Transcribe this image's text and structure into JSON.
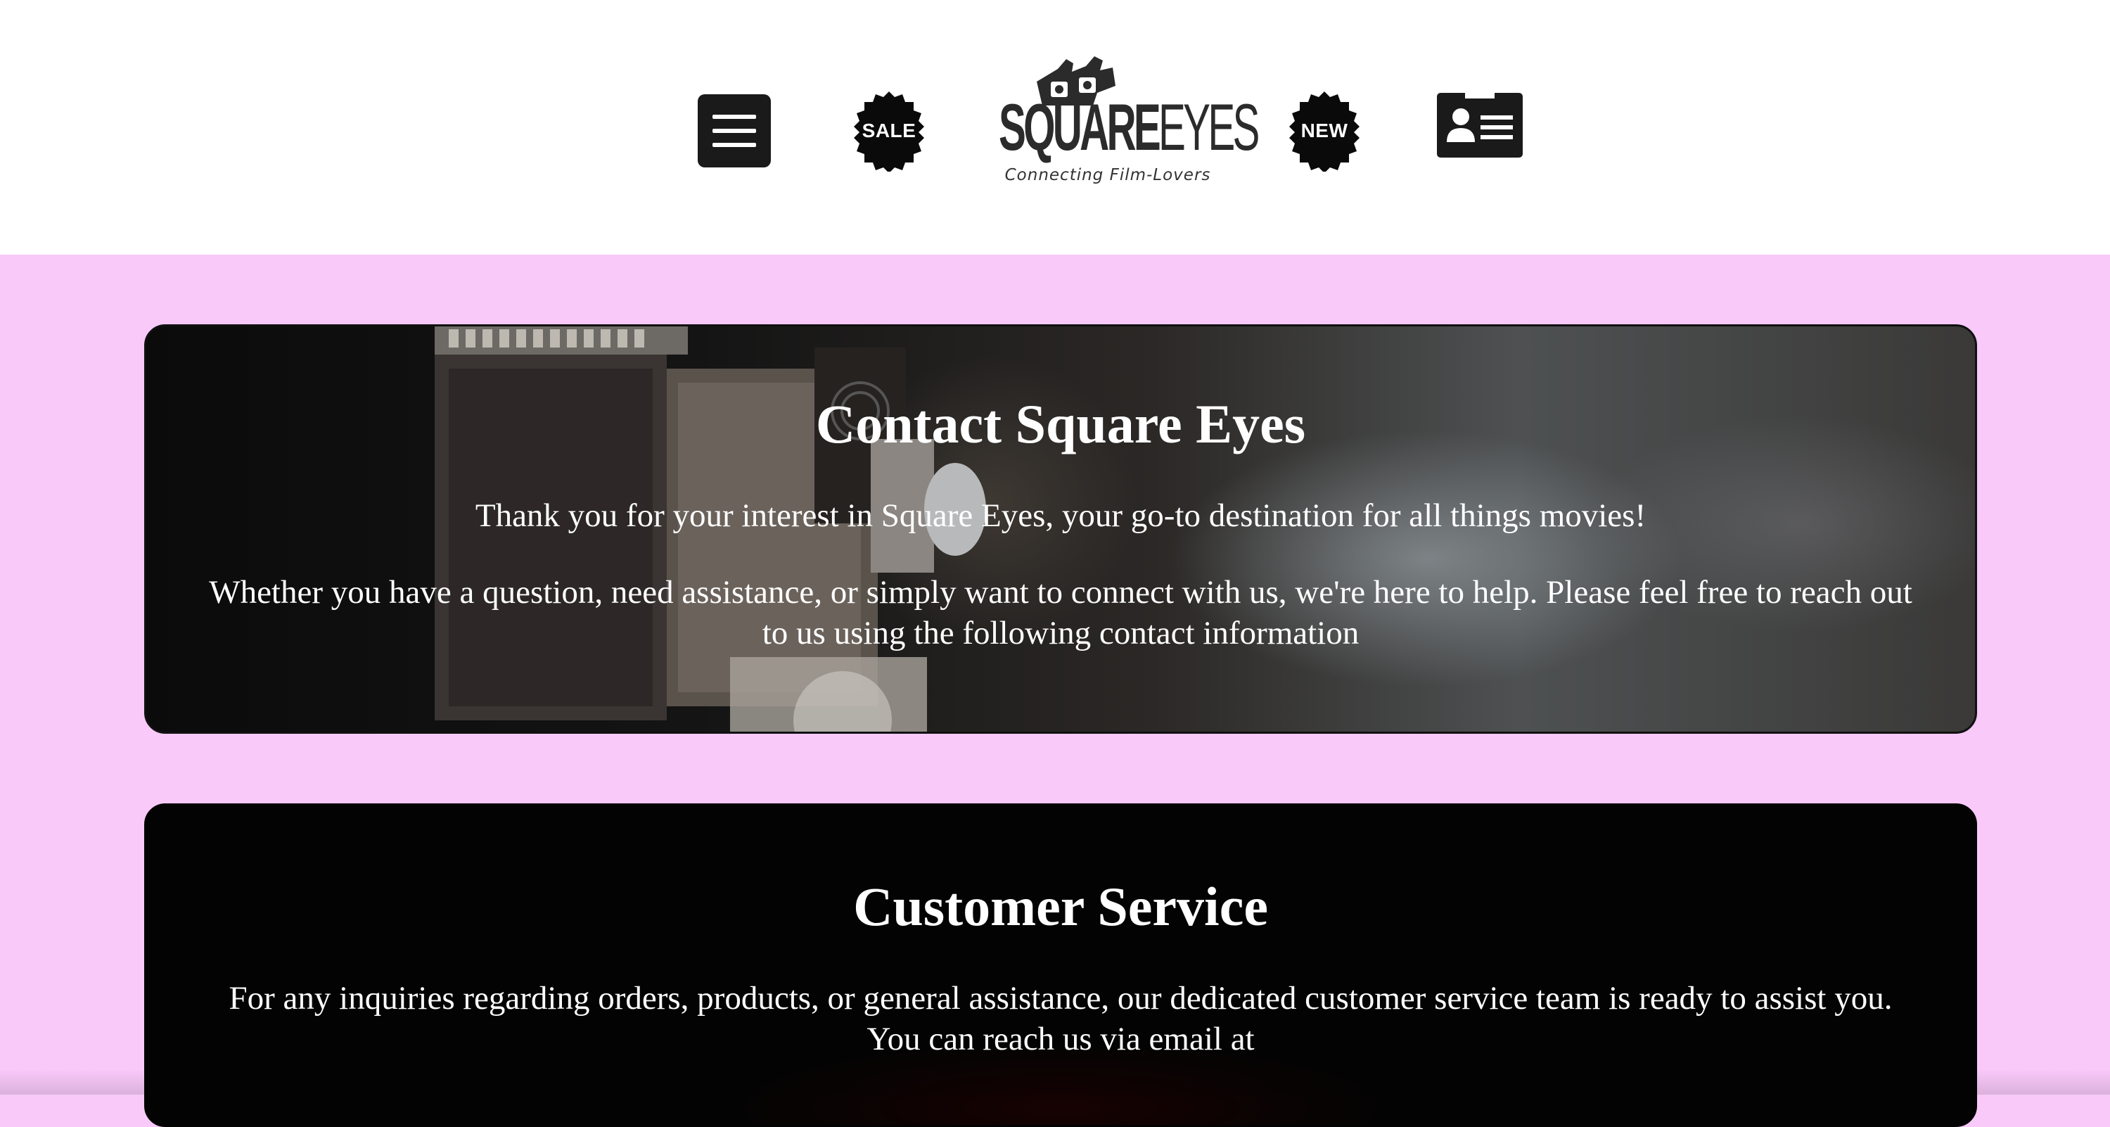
{
  "header": {
    "menu_icon": "hamburger-menu-icon",
    "sale_badge": {
      "label": "SALE",
      "icon": "badge-seal-icon"
    },
    "logo": {
      "word_bold": "SQUARE",
      "word_light": "EYES",
      "tagline": "Connecting Film-Lovers",
      "icon": "3d-glasses-icon"
    },
    "new_badge": {
      "label": "NEW",
      "icon": "badge-seal-icon"
    },
    "contact_icon": "contact-card-icon"
  },
  "contact_section": {
    "title": "Contact Square Eyes",
    "intro": "Thank you for your interest in Square Eyes, your go-to destination for all things movies!",
    "body": "Whether you have a question, need assistance, or simply want to connect with us, we're here to help. Please feel free to reach out to us using the following contact information"
  },
  "service_section": {
    "title": "Customer Service",
    "body": "For any inquiries regarding orders, products, or general assistance, our dedicated customer service team is ready to assist you. You can reach us via email at"
  },
  "colors": {
    "page_background": "#f9c9f9",
    "header_background": "#ffffff",
    "icon_dark": "#1a1a1a",
    "card_text": "#ffffff"
  }
}
